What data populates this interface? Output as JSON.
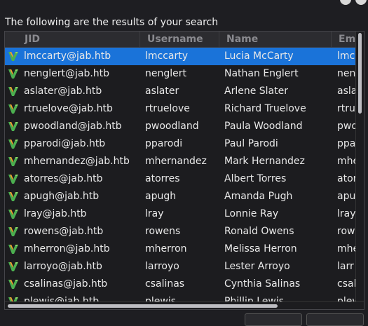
{
  "dialog": {
    "heading": "The following are the results of your search"
  },
  "table": {
    "columns": {
      "jid": "JID",
      "username": "Username",
      "name": "Name",
      "email": "Ema"
    },
    "rows": [
      {
        "jid": "lmccarty@jab.htb",
        "username": "lmccarty",
        "name": "Lucia McCarty",
        "email": "lmc",
        "selected": true
      },
      {
        "jid": "nenglert@jab.htb",
        "username": "nenglert",
        "name": "Nathan Englert",
        "email": "nen"
      },
      {
        "jid": "aslater@jab.htb",
        "username": "aslater",
        "name": "Arlene Slater",
        "email": "asla"
      },
      {
        "jid": "rtruelove@jab.htb",
        "username": "rtruelove",
        "name": "Richard Truelove",
        "email": "rtru"
      },
      {
        "jid": "pwoodland@jab.htb",
        "username": "pwoodland",
        "name": "Paula Woodland",
        "email": "pwo"
      },
      {
        "jid": "pparodi@jab.htb",
        "username": "pparodi",
        "name": "Paul Parodi",
        "email": "ppar"
      },
      {
        "jid": "mhernandez@jab.htb",
        "username": "mhernandez",
        "name": "Mark Hernandez",
        "email": "mhe"
      },
      {
        "jid": "atorres@jab.htb",
        "username": "atorres",
        "name": "Albert Torres",
        "email": "ator"
      },
      {
        "jid": "apugh@jab.htb",
        "username": "apugh",
        "name": "Amanda Pugh",
        "email": "apu"
      },
      {
        "jid": "lray@jab.htb",
        "username": "lray",
        "name": "Lonnie Ray",
        "email": "lray"
      },
      {
        "jid": "rowens@jab.htb",
        "username": "rowens",
        "name": "Ronald Owens",
        "email": "row"
      },
      {
        "jid": "mherron@jab.htb",
        "username": "mherron",
        "name": "Melissa Herron",
        "email": "mhe"
      },
      {
        "jid": "larroyo@jab.htb",
        "username": "larroyo",
        "name": "Lester Arroyo",
        "email": "larr"
      },
      {
        "jid": "csalinas@jab.htb",
        "username": "csalinas",
        "name": "Cynthia Salinas",
        "email": "csal"
      },
      {
        "jid": "plewis@jab.htb",
        "username": "plewis",
        "name": "Phillip Lewis",
        "email": "plew"
      }
    ]
  },
  "icons": {
    "row_icon": "user-contact-icon"
  },
  "colors": {
    "selection": "#1a73d9",
    "icon_green": "#4caf50",
    "icon_orange": "#f0a030"
  }
}
